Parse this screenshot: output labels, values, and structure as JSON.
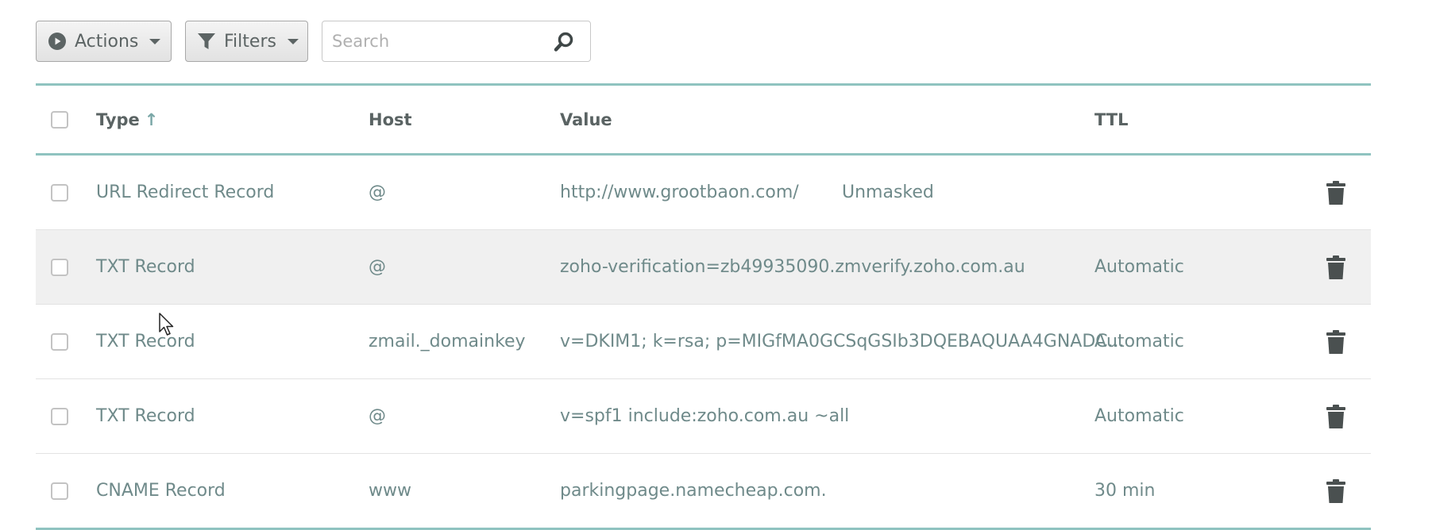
{
  "toolbar": {
    "actions_label": "Actions",
    "filters_label": "Filters",
    "search_placeholder": "Search"
  },
  "table": {
    "columns": {
      "type": "Type",
      "type_sort": "↑",
      "host": "Host",
      "value": "Value",
      "ttl": "TTL"
    },
    "rows": [
      {
        "type": "URL Redirect Record",
        "host": "@",
        "value": "http://www.grootbaon.com/",
        "extra": "Unmasked",
        "ttl": ""
      },
      {
        "type": "TXT Record",
        "host": "@",
        "value": "zoho-verification=zb49935090.zmverify.zoho.com.au",
        "extra": "",
        "ttl": "Automatic"
      },
      {
        "type": "TXT Record",
        "host": "zmail._domainkey",
        "value": "v=DKIM1; k=rsa; p=MIGfMA0GCSqGSIb3DQEBAQUAA4GNADC...",
        "extra": "",
        "ttl": "Automatic"
      },
      {
        "type": "TXT Record",
        "host": "@",
        "value": "v=spf1 include:zoho.com.au ~all",
        "extra": "",
        "ttl": "Automatic"
      },
      {
        "type": "CNAME Record",
        "host": "www",
        "value": "parkingpage.namecheap.com.",
        "extra": "",
        "ttl": "30 min"
      }
    ]
  },
  "colors": {
    "accent_line": "#8fc3c0",
    "text_teal": "#6f8a8a",
    "hover_row": "#f0f0f0"
  },
  "icons": {
    "actions": "play-circle-icon",
    "filters": "funnel-icon",
    "search": "magnifier-icon",
    "delete": "trash-icon",
    "cursor": "mouse-pointer-icon"
  }
}
